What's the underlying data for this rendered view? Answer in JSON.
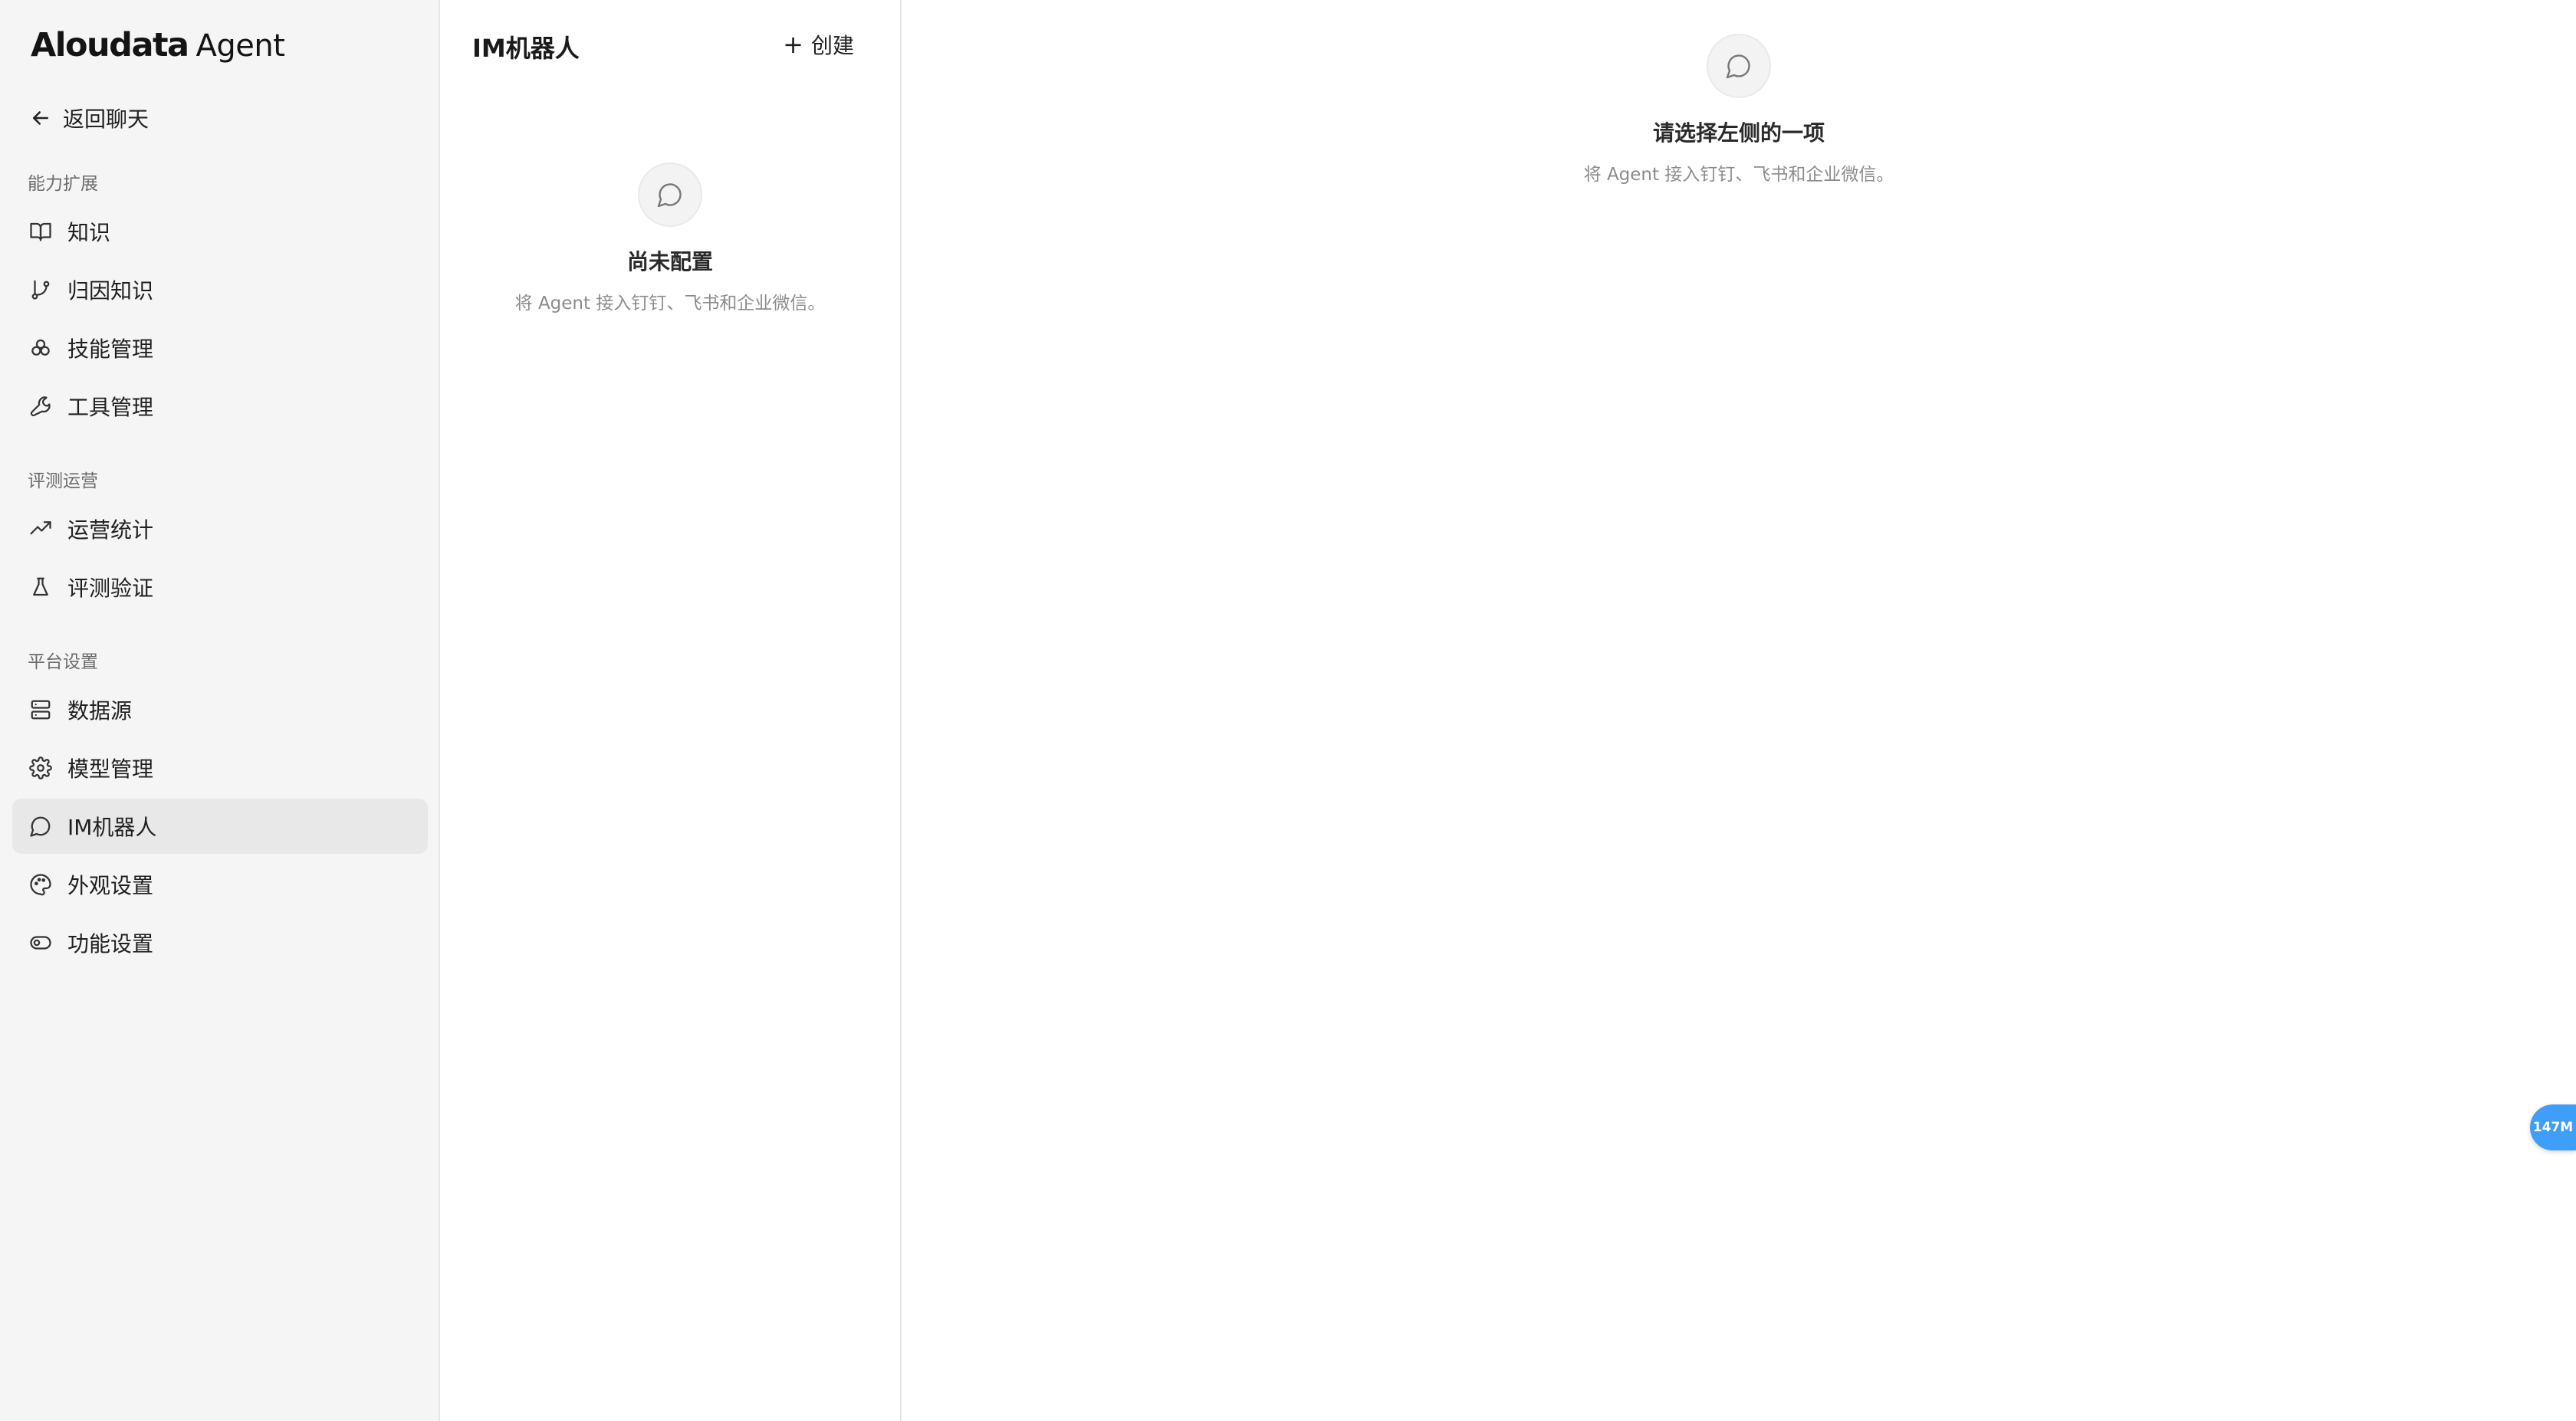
{
  "brand": {
    "name": "Aloudata",
    "sub": "Agent"
  },
  "back": {
    "label": "返回聊天"
  },
  "sidebar": {
    "sections": [
      {
        "title": "能力扩展",
        "items": [
          {
            "label": "知识",
            "icon": "book-icon"
          },
          {
            "label": "归因知识",
            "icon": "git-branch-icon"
          },
          {
            "label": "技能管理",
            "icon": "skills-icon"
          },
          {
            "label": "工具管理",
            "icon": "wrench-icon"
          }
        ]
      },
      {
        "title": "评测运营",
        "items": [
          {
            "label": "运营统计",
            "icon": "trending-up-icon"
          },
          {
            "label": "评测验证",
            "icon": "flask-icon"
          }
        ]
      },
      {
        "title": "平台设置",
        "items": [
          {
            "label": "数据源",
            "icon": "server-icon"
          },
          {
            "label": "模型管理",
            "icon": "gear-icon"
          },
          {
            "label": "IM机器人",
            "icon": "chat-bubble-icon",
            "active": true
          },
          {
            "label": "外观设置",
            "icon": "palette-icon"
          },
          {
            "label": "功能设置",
            "icon": "toggle-icon"
          }
        ]
      }
    ]
  },
  "panel": {
    "title": "IM机器人",
    "create_label": "创建",
    "empty_title": "尚未配置",
    "empty_desc": "将 Agent 接入钉钉、飞书和企业微信。"
  },
  "main": {
    "empty_title": "请选择左侧的一项",
    "empty_desc": "将 Agent 接入钉钉、飞书和企业微信。"
  },
  "mem_badge": "147M",
  "colors": {
    "active_bg": "#e8e8e8",
    "sidebar_bg": "#f5f5f5",
    "badge": "#3f9ef7"
  }
}
